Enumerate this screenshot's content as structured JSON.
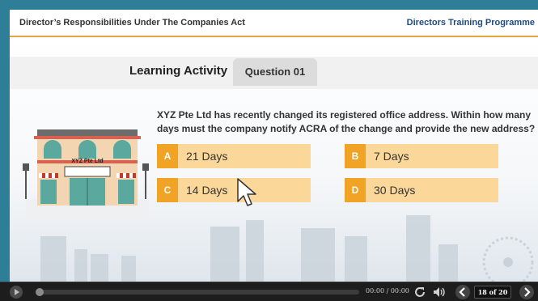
{
  "header": {
    "course_title": "Director’s Responsibilities Under The Companies Act",
    "programme_title": "Directors Training Programme"
  },
  "activity": {
    "label": "Learning Activity",
    "question_tab": "Question 01",
    "question_text": "XYZ Pte Ltd has recently changed its registered office address. Within how many days must the company notify ACRA of the change and provide the new address?",
    "building_sign": "XYZ Pte Ltd",
    "options": [
      {
        "letter": "A",
        "text": "21 Days"
      },
      {
        "letter": "B",
        "text": "7 Days"
      },
      {
        "letter": "C",
        "text": "14 Days"
      },
      {
        "letter": "D",
        "text": "30 Days"
      }
    ]
  },
  "player": {
    "time": "00:00 / 00:00",
    "progress": 0.0,
    "slide_counter": "18 of 20",
    "icons": [
      "play-icon",
      "replay-icon",
      "volume-icon",
      "prev-icon",
      "next-icon"
    ]
  },
  "colors": {
    "accent": "#f0a324",
    "option_bg": "#fbd89a",
    "programme_title": "#1d4a86",
    "frame": "#2f7e97"
  }
}
